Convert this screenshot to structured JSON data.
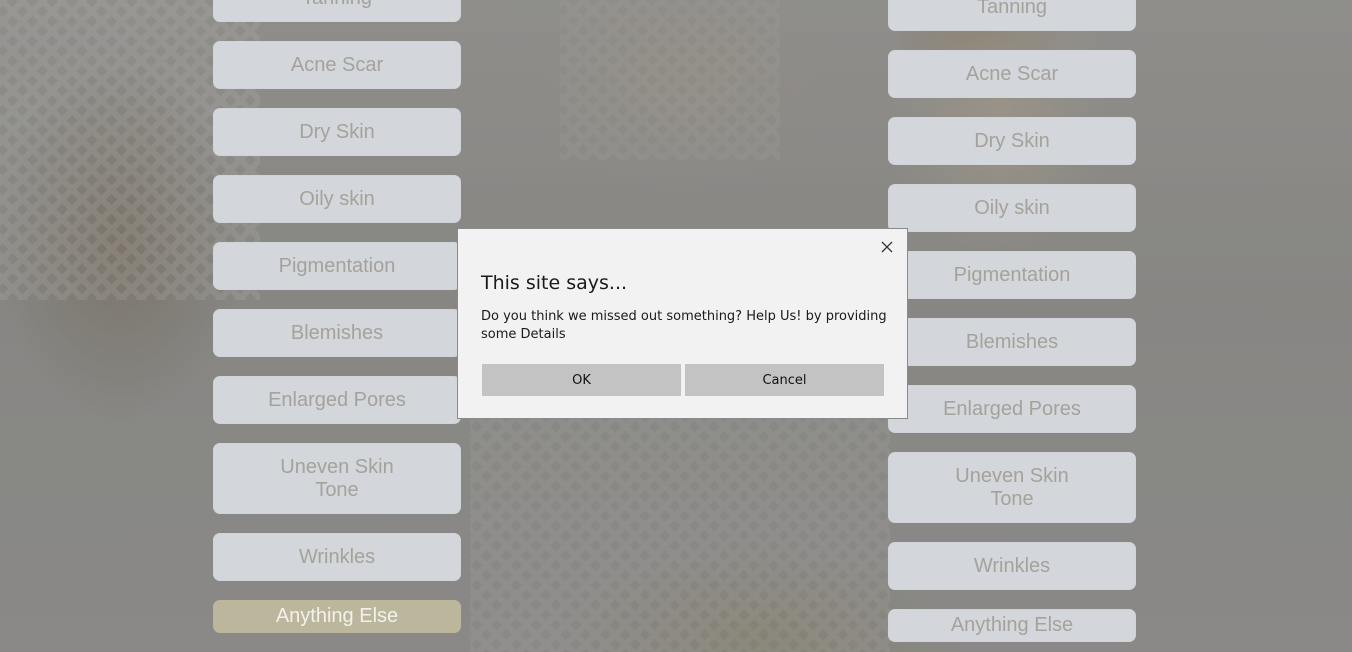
{
  "left_options": [
    {
      "label": "Tanning"
    },
    {
      "label": "Acne Scar"
    },
    {
      "label": "Dry Skin"
    },
    {
      "label": "Oily skin"
    },
    {
      "label": "Pigmentation"
    },
    {
      "label": "Blemishes"
    },
    {
      "label": "Enlarged Pores"
    },
    {
      "label": "Uneven Skin Tone"
    },
    {
      "label": "Wrinkles"
    },
    {
      "label": "Anything Else",
      "selected": true
    }
  ],
  "right_options": [
    {
      "label": "Tanning"
    },
    {
      "label": "Acne Scar"
    },
    {
      "label": "Dry Skin"
    },
    {
      "label": "Oily skin"
    },
    {
      "label": "Pigmentation"
    },
    {
      "label": "Blemishes"
    },
    {
      "label": "Enlarged Pores"
    },
    {
      "label": "Uneven Skin Tone"
    },
    {
      "label": "Wrinkles"
    },
    {
      "label": "Anything Else"
    }
  ],
  "dialog": {
    "title": "This site says...",
    "message": "Do you think we missed out something? Help Us! by providing some Details",
    "ok_label": "OK",
    "cancel_label": "Cancel",
    "close_icon": "close-icon"
  },
  "colors": {
    "chip_bg": "#d3d6db",
    "chip_text": "#a4a29a",
    "selected_bg": "#bcb79c",
    "dialog_bg": "#f2f2f2",
    "dialog_button_bg": "#c3c3c3"
  }
}
